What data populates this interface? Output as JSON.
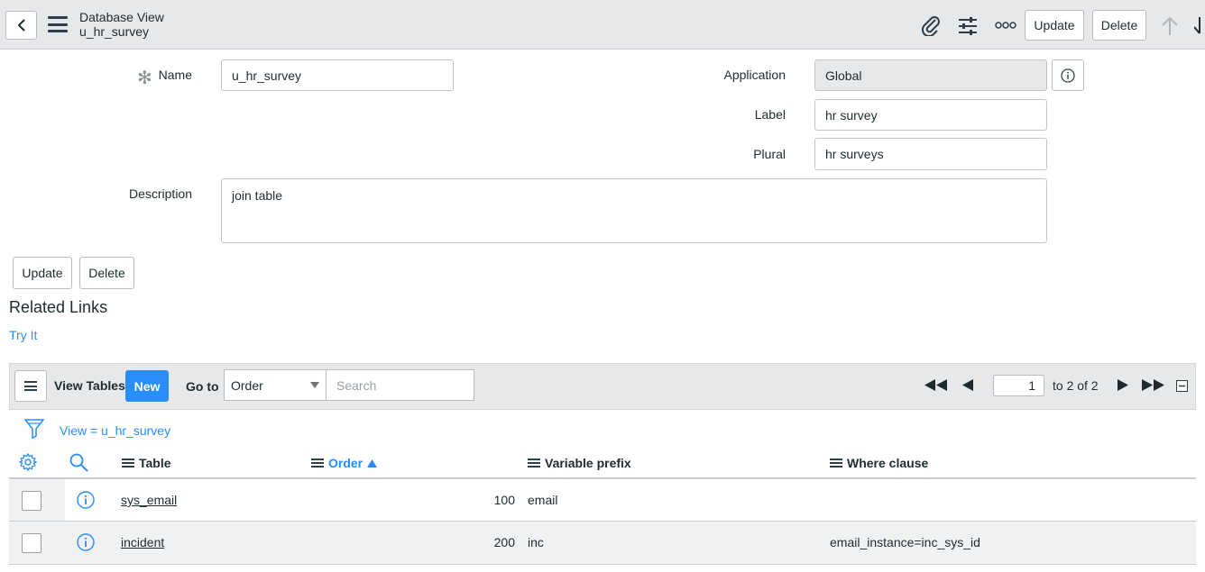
{
  "header": {
    "title": "Database View",
    "subtitle": "u_hr_survey",
    "update_label": "Update",
    "delete_label": "Delete"
  },
  "form": {
    "name_label": "Name",
    "name_value": "u_hr_survey",
    "application_label": "Application",
    "application_value": "Global",
    "label_label": "Label",
    "label_value": "hr survey",
    "plural_label": "Plural",
    "plural_value": "hr surveys",
    "description_label": "Description",
    "description_value": "join table",
    "update_label": "Update",
    "delete_label": "Delete"
  },
  "related": {
    "title": "Related Links",
    "try_it": "Try It"
  },
  "list": {
    "title": "View Tables",
    "new_label": "New",
    "goto_label": "Go to",
    "select_value": "Order",
    "search_placeholder": "Search",
    "page_value": "1",
    "page_of": "to 2 of 2",
    "filter_text": "View = u_hr_survey",
    "columns": {
      "table": "Table",
      "order": "Order",
      "variable_prefix": "Variable prefix",
      "where_clause": "Where clause"
    },
    "rows": [
      {
        "table": "sys_email",
        "order": "100",
        "variable_prefix": "email",
        "where_clause": ""
      },
      {
        "table": "incident",
        "order": "200",
        "variable_prefix": "inc",
        "where_clause": "email_instance=inc_sys_id"
      }
    ]
  },
  "colors": {
    "accent": "#278efc",
    "header_bg": "#e6e8ea",
    "text": "#1f2b2f"
  }
}
